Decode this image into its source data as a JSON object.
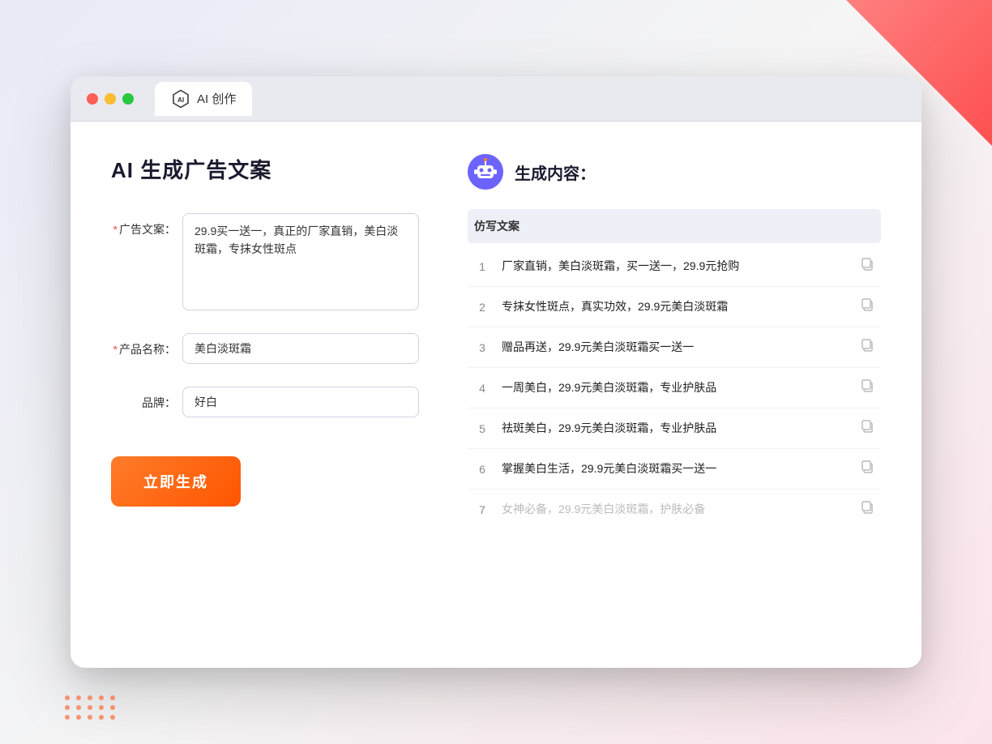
{
  "window": {
    "tab_label": "AI 创作"
  },
  "page": {
    "title": "AI 生成广告文案"
  },
  "form": {
    "ad_copy_label": "广告文案：",
    "ad_copy_required": "*",
    "ad_copy_value": "29.9买一送一，真正的厂家直销，美白淡斑霜，专抹女性斑点",
    "product_name_label": "产品名称：",
    "product_name_required": "*",
    "product_name_value": "美白淡斑霜",
    "brand_label": "品牌：",
    "brand_value": "好白",
    "submit_label": "立即生成"
  },
  "results": {
    "header_icon": "robot",
    "header_title": "生成内容：",
    "column_header": "仿写文案",
    "items": [
      {
        "index": "1",
        "text": "厂家直销，美白淡斑霜，买一送一，29.9元抢购",
        "muted": false
      },
      {
        "index": "2",
        "text": "专抹女性斑点，真实功效，29.9元美白淡斑霜",
        "muted": false
      },
      {
        "index": "3",
        "text": "赠品再送，29.9元美白淡斑霜买一送一",
        "muted": false
      },
      {
        "index": "4",
        "text": "一周美白，29.9元美白淡斑霜，专业护肤品",
        "muted": false
      },
      {
        "index": "5",
        "text": "祛斑美白，29.9元美白淡斑霜，专业护肤品",
        "muted": false
      },
      {
        "index": "6",
        "text": "掌握美白生活，29.9元美白淡斑霜买一送一",
        "muted": false
      },
      {
        "index": "7",
        "text": "女神必备，29.9元美白淡斑霜，护肤必备",
        "muted": true
      }
    ]
  },
  "colors": {
    "accent": "#ff7c2a",
    "primary": "#6c63ff",
    "bg": "#f0f2f8"
  }
}
